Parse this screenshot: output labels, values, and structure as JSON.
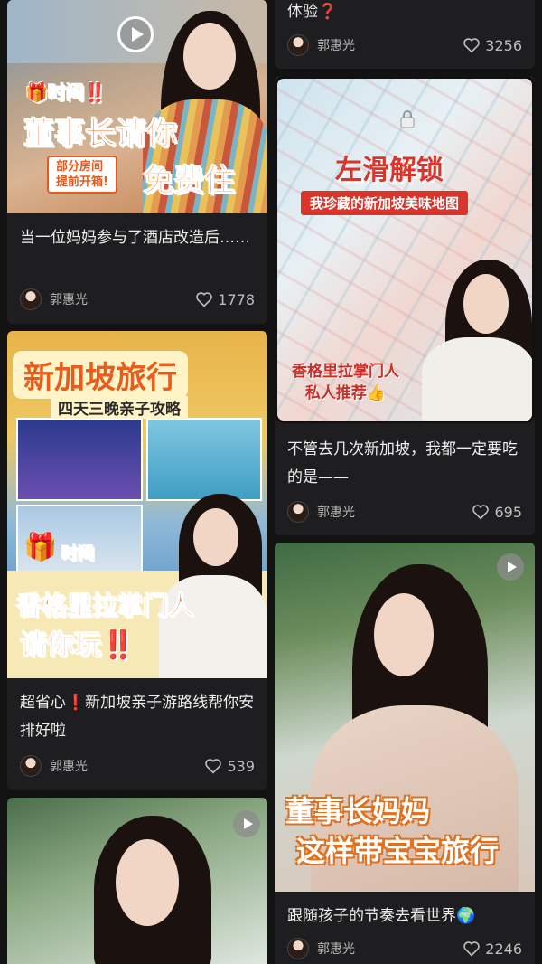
{
  "cards": [
    {
      "id": "hotel",
      "title": "当一位妈妈参与了酒店改造后……",
      "author": "郭惠光",
      "likes": "1778",
      "overlay_time": "🎁时间‼️",
      "overlay_main": "董事长请你",
      "overlay_free": "免费住",
      "overlay_sub": "部分房间\n提前开箱!"
    },
    {
      "id": "top-partial",
      "title": "体验❓",
      "author": "郭惠光",
      "likes": "3256"
    },
    {
      "id": "map",
      "title": "不管去几次新加坡，我都一定要吃的是——",
      "author": "郭惠光",
      "likes": "695",
      "overlay_main": "左滑解锁",
      "overlay_sub": "我珍藏的新加坡美味地图",
      "overlay_bottom": "香格里拉掌门人\n私人推荐👍"
    },
    {
      "id": "travel",
      "title": "超省心❗️新加坡亲子游路线帮你安排好啦",
      "author": "郭惠光",
      "likes": "539",
      "overlay_main": "新加坡旅行",
      "overlay_sub": "四天三晚亲子攻略",
      "overlay_time": "时间",
      "overlay_bottom1": "香格里拉掌门人",
      "overlay_bottom2": "请你玩‼️"
    },
    {
      "id": "interview",
      "title": "跟随孩子的节奏去看世界🌍",
      "author": "郭惠光",
      "likes": "2246",
      "overlay_line1": "董事长妈妈",
      "overlay_line2": "这样带宝宝旅行"
    },
    {
      "id": "bottom-partial"
    }
  ],
  "colors": {
    "background": "#121212",
    "card": "#1e1e20",
    "accent_orange": "#f26b1f"
  }
}
